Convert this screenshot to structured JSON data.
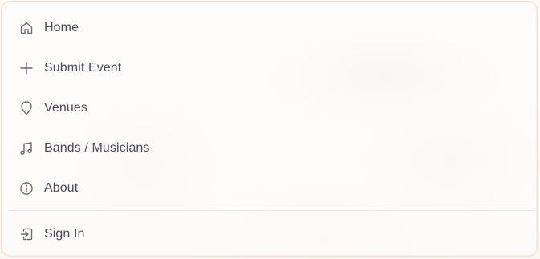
{
  "menu": {
    "items": [
      {
        "label": "Home",
        "icon": "home-icon"
      },
      {
        "label": "Submit Event",
        "icon": "plus-icon"
      },
      {
        "label": "Venues",
        "icon": "map-pin-icon"
      },
      {
        "label": "Bands / Musicians",
        "icon": "music-note-icon"
      },
      {
        "label": "About",
        "icon": "info-icon"
      }
    ],
    "footer": {
      "label": "Sign In",
      "icon": "sign-in-icon"
    }
  },
  "colors": {
    "text": "#4a4d57",
    "icon": "#6b6e76",
    "border": "#f3dfd2",
    "divider": "#ece7e3"
  }
}
